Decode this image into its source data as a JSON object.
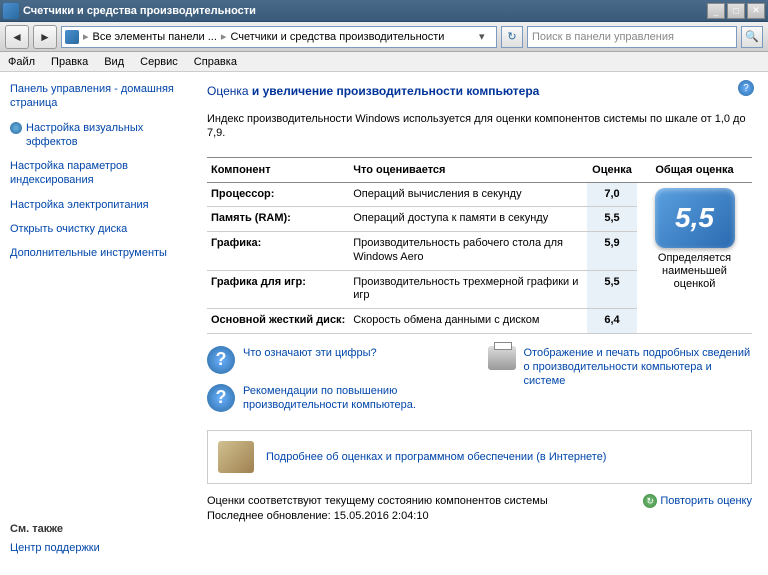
{
  "window": {
    "title": "Счетчики и средства производительности"
  },
  "nav": {
    "breadcrumb1": "Все элементы панели ...",
    "breadcrumb2": "Счетчики и средства производительности",
    "search_placeholder": "Поиск в панели управления"
  },
  "menu": {
    "file": "Файл",
    "edit": "Правка",
    "view": "Вид",
    "service": "Сервис",
    "help": "Справка"
  },
  "sidebar": {
    "home": "Панель управления - домашняя страница",
    "visual": "Настройка визуальных эффектов",
    "index": "Настройка параметров индексирования",
    "power": "Настройка электропитания",
    "cleanup": "Открыть очистку диска",
    "tools": "Дополнительные инструменты",
    "also_hdr": "См. также",
    "support": "Центр поддержки"
  },
  "main": {
    "heading_pre": "Оценка",
    "heading_post": "и увеличение производительности компьютера",
    "description": "Индекс производительности Windows используется для оценки компонентов системы по шкале от 1,0 до 7,9.",
    "th_component": "Компонент",
    "th_what": "Что оценивается",
    "th_sub": "Оценка",
    "th_overall": "Общая оценка",
    "rows": [
      {
        "comp": "Процессор:",
        "what": "Операций вычисления в секунду",
        "sub": "7,0"
      },
      {
        "comp": "Память (RAM):",
        "what": "Операций доступа к памяти в секунду",
        "sub": "5,5"
      },
      {
        "comp": "Графика:",
        "what": "Производительность рабочего стола для Windows Aero",
        "sub": "5,9"
      },
      {
        "comp": "Графика для игр:",
        "what": "Производительность трехмерной графики и игр",
        "sub": "5,5"
      },
      {
        "comp": "Основной жесткий диск:",
        "what": "Скорость обмена данными с диском",
        "sub": "6,4"
      }
    ],
    "overall_score": "5,5",
    "overall_label": "Определяется наименьшей оценкой",
    "link_what": "Что означают эти цифры?",
    "link_rec": "Рекомендации по повышению производительности компьютера.",
    "link_print": "Отображение и печать подробных сведений о производительности компьютера и системе",
    "link_solutions": "Подробнее об оценках и программном обеспечении (в Интернете)",
    "footer_line1": "Оценки соответствуют текущему состоянию компонентов системы",
    "footer_line2": "Последнее обновление: 15.05.2016 2:04:10",
    "refresh": "Повторить оценку"
  }
}
